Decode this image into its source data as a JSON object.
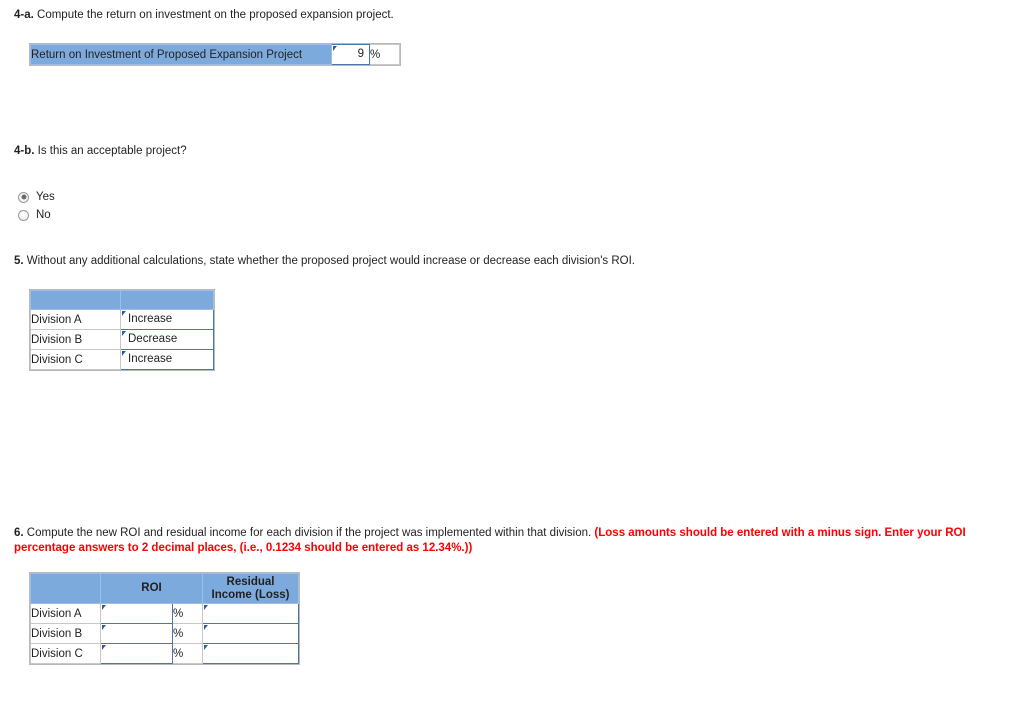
{
  "colors": {
    "header_blue": "#7daadd",
    "field_border_blue": "#4877ab",
    "warning_red": "#ff0000"
  },
  "q4a": {
    "number": "4-a.",
    "prompt": "Compute the return on investment on the proposed expansion project.",
    "row_label": "Return on Investment of Proposed Expansion Project",
    "value": "9",
    "unit": "%"
  },
  "q4b": {
    "number": "4-b.",
    "prompt": "Is this an acceptable project?",
    "options": [
      {
        "label": "Yes",
        "selected": true
      },
      {
        "label": "No",
        "selected": false
      }
    ]
  },
  "q5": {
    "number": "5.",
    "prompt": "Without any additional calculations, state whether the proposed project would increase or decrease each division's ROI.",
    "headers": [
      "",
      ""
    ],
    "rows": [
      {
        "division": "Division A",
        "answer": "Increase"
      },
      {
        "division": "Division B",
        "answer": "Decrease"
      },
      {
        "division": "Division C",
        "answer": "Increase"
      }
    ]
  },
  "q6": {
    "number": "6.",
    "prompt": "Compute the new ROI and residual income for each division if the project was implemented within that division.",
    "warning": "(Loss amounts should be entered with a minus sign. Enter your ROI percentage answers to 2 decimal places, (i.e., 0.1234 should be entered as 12.34%.))",
    "headers": {
      "blank": "",
      "roi": "ROI",
      "residual_line1": "Residual",
      "residual_line2": "Income (Loss)"
    },
    "unit": "%",
    "rows": [
      {
        "division": "Division A",
        "roi": "",
        "residual": ""
      },
      {
        "division": "Division B",
        "roi": "",
        "residual": ""
      },
      {
        "division": "Division C",
        "roi": "",
        "residual": ""
      }
    ]
  }
}
